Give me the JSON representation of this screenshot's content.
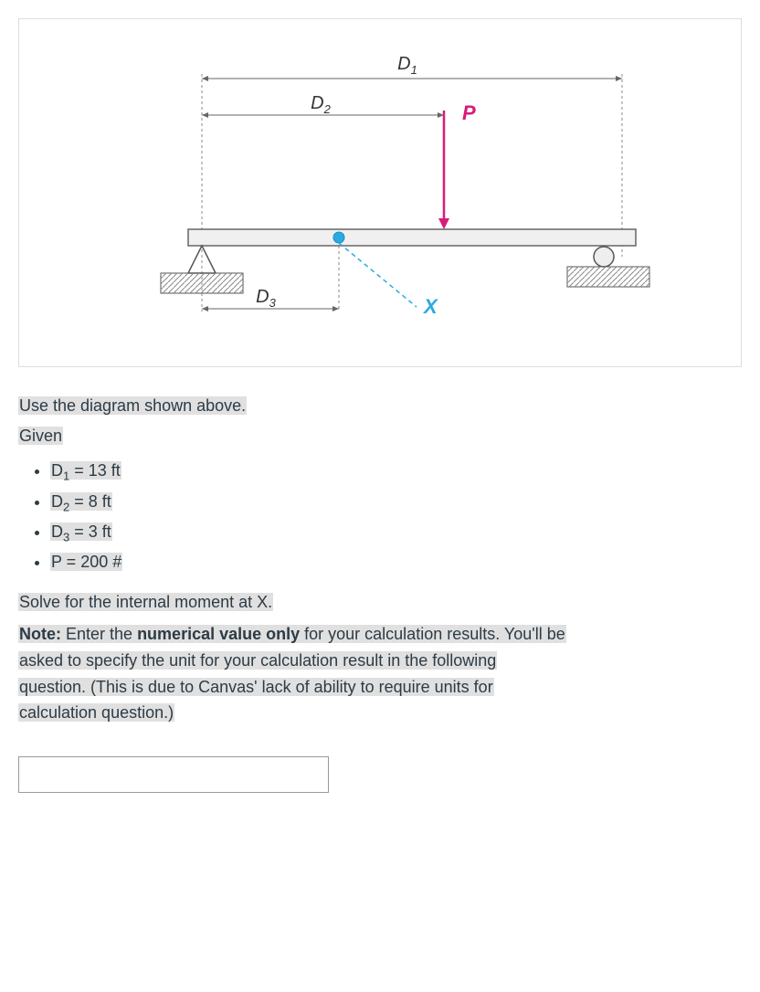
{
  "diagram": {
    "labels": {
      "d1": "D",
      "d1_sub": "1",
      "d2": "D",
      "d2_sub": "2",
      "d3": "D",
      "d3_sub": "3",
      "p": "P",
      "x": "X"
    }
  },
  "text": {
    "instruction": "Use the diagram shown above.",
    "given_label": "Given",
    "items": {
      "d1": "D",
      "d1_sub": "1",
      "d1_val": " = 13 ft",
      "d2": "D",
      "d2_sub": "2",
      "d2_val": " = 8 ft",
      "d3": "D",
      "d3_sub": "3",
      "d3_val": " = 3 ft",
      "p": "P = 200 #"
    },
    "solve": "Solve for the internal moment at X.",
    "note_bold": "Note:",
    "note_1": " Enter the ",
    "note_bold2": "numerical value only",
    "note_2": " for your calculation results. You'll be",
    "note_3": "asked to specify the unit for your calculation result in the following",
    "note_4": "question. (This is due to Canvas' lack of ability to require units for",
    "note_5": "calculation question.)"
  }
}
